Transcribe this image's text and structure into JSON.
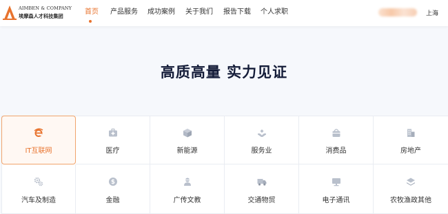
{
  "brand": {
    "name_en": "AIMBEN & COMPANY",
    "name_cn": "埃摩森人才科技集团",
    "accent_color": "#e8732e"
  },
  "nav": {
    "items": [
      {
        "label": "首页",
        "active": true
      },
      {
        "label": "产品服务",
        "active": false
      },
      {
        "label": "成功案例",
        "active": false
      },
      {
        "label": "关于我们",
        "active": false
      },
      {
        "label": "报告下载",
        "active": false
      },
      {
        "label": "个人求职",
        "active": false
      }
    ]
  },
  "header_right": {
    "city": "上海"
  },
  "section": {
    "title": "高质高量 实力见证"
  },
  "industries": [
    {
      "label": "IT互联网",
      "icon": "ie-icon",
      "active": true
    },
    {
      "label": "医疗",
      "icon": "medical-kit-icon",
      "active": false
    },
    {
      "label": "新能源",
      "icon": "cube-icon",
      "active": false
    },
    {
      "label": "服务业",
      "icon": "service-hand-icon",
      "active": false
    },
    {
      "label": "消费品",
      "icon": "shopping-bag-icon",
      "active": false
    },
    {
      "label": "房地产",
      "icon": "building-icon",
      "active": false
    },
    {
      "label": "汽车及制造",
      "icon": "gears-icon",
      "active": false
    },
    {
      "label": "金融",
      "icon": "dollar-coin-icon",
      "active": false
    },
    {
      "label": "广传文教",
      "icon": "person-icon",
      "active": false
    },
    {
      "label": "交通物贸",
      "icon": "truck-icon",
      "active": false
    },
    {
      "label": "电子通讯",
      "icon": "monitor-icon",
      "active": false
    },
    {
      "label": "农牧渔政其他",
      "icon": "layers-icon",
      "active": false
    }
  ]
}
